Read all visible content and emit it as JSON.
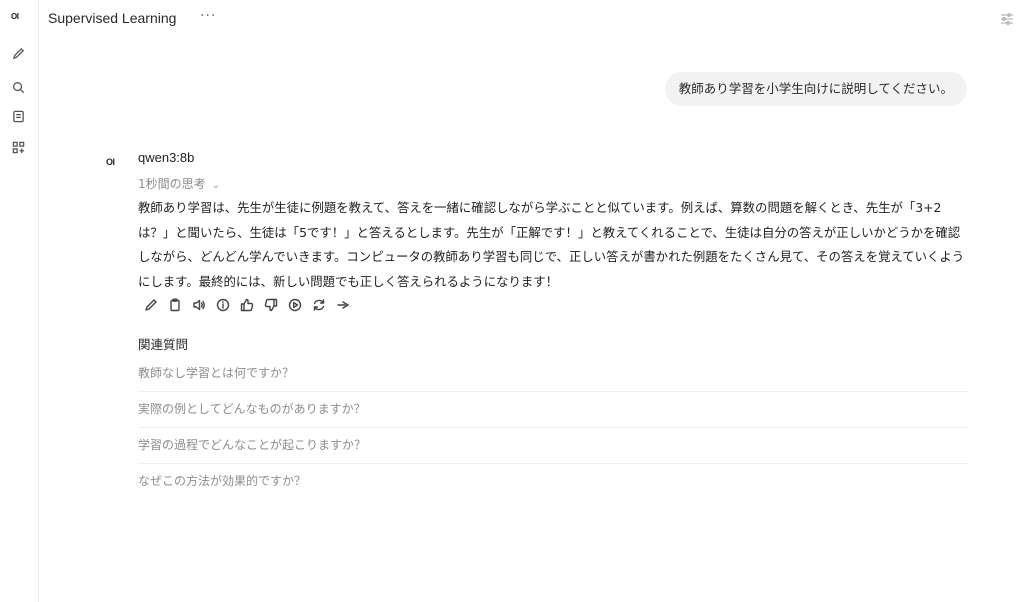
{
  "sidebar": {
    "logo": "OI",
    "icons": [
      "pencil-icon",
      "search-icon",
      "notebook-icon",
      "apps-icon"
    ]
  },
  "header": {
    "title": "Supervised Learning",
    "more": "···",
    "controls_icon": "sliders-icon"
  },
  "user_message": "教師あり学習を小学生向けに説明してください。",
  "assistant": {
    "avatar": "OI",
    "model": "qwen3:8b",
    "thinking_label": "1秒間の思考",
    "answer": "教師あり学習は、先生が生徒に例題を教えて、答えを一緒に確認しながら学ぶことと似ています。例えば、算数の問題を解くとき、先生が「3+2は？」と聞いたら、生徒は「5です！」と答えるとします。先生が「正解です！」と教えてくれることで、生徒は自分の答えが正しいかどうかを確認しながら、どんどん学んでいきます。コンピュータの教師あり学習も同じで、正しい答えが書かれた例題をたくさん見て、その答えを覚えていくようにします。最終的には、新しい問題でも正しく答えられるようになります！",
    "action_icons": [
      "edit-icon",
      "copy-icon",
      "speaker-icon",
      "info-icon",
      "thumbs-up-icon",
      "thumbs-down-icon",
      "play-icon",
      "regenerate-icon",
      "continue-icon"
    ]
  },
  "related": {
    "title": "関連質問",
    "items": [
      "教師なし学習とは何ですか？",
      "実際の例としてどんなものがありますか？",
      "学習の過程でどんなことが起こりますか？",
      "なぜこの方法が効果的ですか？"
    ]
  },
  "colors": {
    "bubble": "#f2f2f2",
    "muted_text": "#8d8d8d",
    "divider": "#efefef"
  }
}
